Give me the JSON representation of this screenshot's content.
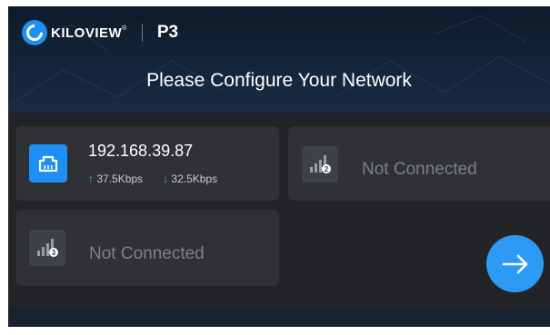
{
  "brand": {
    "logo_text": "KILOVIEW",
    "trademark": "®",
    "model": "P3",
    "accent": "#1e8ff5"
  },
  "title": "Please Configure Your Network",
  "connections": [
    {
      "type": "ethernet",
      "icon": "ethernet-icon",
      "ip": "192.168.39.87",
      "upload": "37.5Kbps",
      "download": "32.5Kbps",
      "up_arrow": "↑",
      "down_arrow": "↓"
    },
    {
      "type": "cellular",
      "icon": "signal-2-icon",
      "index": "2",
      "status": "Not Connected"
    },
    {
      "type": "cellular",
      "icon": "signal-3-icon",
      "index": "3",
      "status": "Not Connected"
    }
  ],
  "next_button": {
    "icon": "arrow-right-icon",
    "color": "#2d9bf5"
  }
}
